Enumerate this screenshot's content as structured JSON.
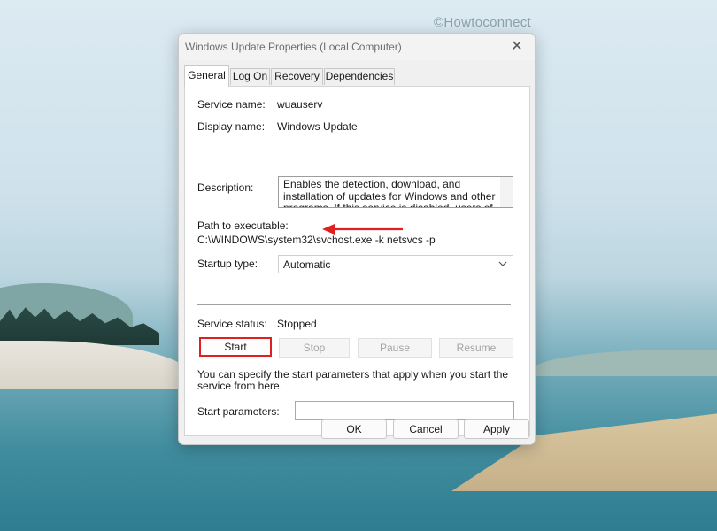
{
  "watermark": "©Howtoconnect",
  "dialog": {
    "title": "Windows Update Properties (Local Computer)",
    "close_icon": "close-icon"
  },
  "tabs": [
    {
      "label": "General",
      "active": true
    },
    {
      "label": "Log On",
      "active": false
    },
    {
      "label": "Recovery",
      "active": false
    },
    {
      "label": "Dependencies",
      "active": false
    }
  ],
  "general": {
    "service_name_label": "Service name:",
    "service_name_value": "wuauserv",
    "display_name_label": "Display name:",
    "display_name_value": "Windows Update",
    "description_label": "Description:",
    "description_value": "Enables the detection, download, and installation of updates for Windows and other programs. If this service is disabled, users of this computer will not be",
    "path_label": "Path to executable:",
    "path_value": "C:\\WINDOWS\\system32\\svchost.exe -k netsvcs -p",
    "startup_type_label": "Startup type:",
    "startup_type_value": "Automatic",
    "service_status_label": "Service status:",
    "service_status_value": "Stopped",
    "buttons": {
      "start": "Start",
      "stop": "Stop",
      "pause": "Pause",
      "resume": "Resume"
    },
    "start_params_help": "You can specify the start parameters that apply when you start the service from here.",
    "start_params_label": "Start parameters:",
    "start_params_value": ""
  },
  "footer": {
    "ok": "OK",
    "cancel": "Cancel",
    "apply": "Apply"
  },
  "colors": {
    "highlight": "#e02020",
    "arrow": "#e02020"
  }
}
